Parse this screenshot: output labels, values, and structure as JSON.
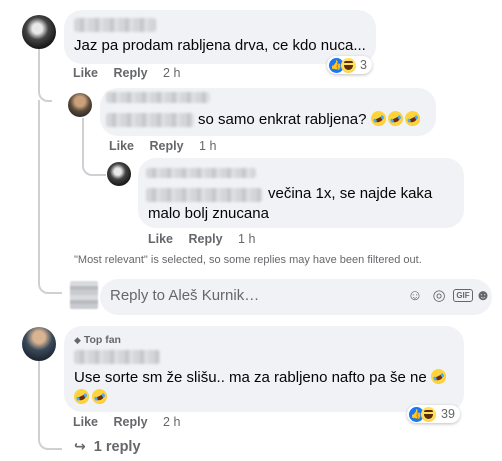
{
  "comments": [
    {
      "text": "Jaz pa prodam rabljena drva, ce kdo nuca...",
      "actions": {
        "like": "Like",
        "reply": "Reply",
        "time": "2 h"
      },
      "reaction_count": "3"
    },
    {
      "text": "so samo enkrat rabljena?",
      "actions": {
        "like": "Like",
        "reply": "Reply",
        "time": "1 h"
      }
    },
    {
      "text_line1": "večina 1x, se najde kaka",
      "text_line2": "malo bolj znucana",
      "actions": {
        "like": "Like",
        "reply": "Reply",
        "time": "1 h"
      }
    },
    {
      "badge": "Top fan",
      "text": "Use sorte sm že slišu.. ma za rabljeno nafto pa še ne",
      "actions": {
        "like": "Like",
        "reply": "Reply",
        "time": "2 h"
      },
      "reaction_count": "39",
      "view_replies": "1 reply"
    }
  ],
  "filter_notice": "\"Most relevant\" is selected, so some replies may have been filtered out.",
  "reply_box": {
    "placeholder": "Reply to Aleš Kurnik…"
  },
  "icons": [
    "emoji-icon",
    "camera-icon",
    "gif-icon",
    "sticker-icon",
    "reply-arrow-icon",
    "like-reaction-icon",
    "haha-reaction-icon",
    "rofl-emoji-icon",
    "top-fan-icon"
  ]
}
